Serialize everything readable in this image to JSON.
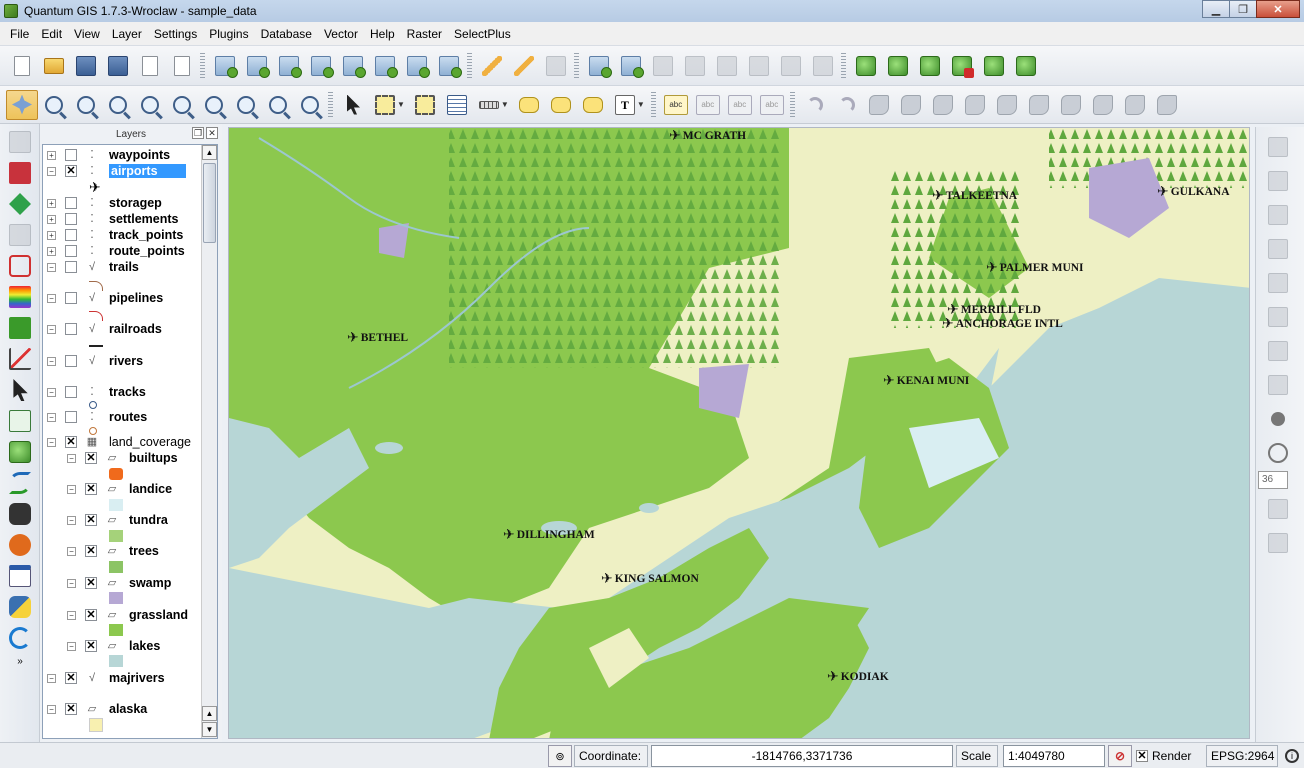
{
  "window": {
    "title": "Quantum GIS 1.7.3-Wroclaw - sample_data"
  },
  "menu": [
    {
      "label": "File"
    },
    {
      "label": "Edit"
    },
    {
      "label": "View"
    },
    {
      "label": "Layer"
    },
    {
      "label": "Settings"
    },
    {
      "label": "Plugins"
    },
    {
      "label": "Database"
    },
    {
      "label": "Vector"
    },
    {
      "label": "Help"
    },
    {
      "label": "Raster"
    },
    {
      "label": "SelectPlus"
    }
  ],
  "layers_panel": {
    "title": "Layers",
    "layers": [
      {
        "name": "waypoints",
        "checked": false,
        "selected": false
      },
      {
        "name": "airports",
        "checked": true,
        "selected": true
      },
      {
        "name": "storagep",
        "checked": false
      },
      {
        "name": "settlements",
        "checked": false
      },
      {
        "name": "track_points",
        "checked": false
      },
      {
        "name": "route_points",
        "checked": false
      },
      {
        "name": "trails",
        "checked": false
      },
      {
        "name": "pipelines",
        "checked": false
      },
      {
        "name": "railroads",
        "checked": false
      },
      {
        "name": "rivers",
        "checked": false
      },
      {
        "name": "tracks",
        "checked": false
      },
      {
        "name": "routes",
        "checked": false
      },
      {
        "name": "land_coverage",
        "checked": true,
        "group": true
      },
      {
        "name": "builtups",
        "checked": true,
        "color": "#f06a1c"
      },
      {
        "name": "landice",
        "checked": true,
        "color": "#d9eef2"
      },
      {
        "name": "tundra",
        "checked": true,
        "color": "#a5d27a"
      },
      {
        "name": "trees",
        "checked": true,
        "color": "#8cc465"
      },
      {
        "name": "swamp",
        "checked": true,
        "color": "#b6a8d4"
      },
      {
        "name": "grassland",
        "checked": true,
        "color": "#8cc84e"
      },
      {
        "name": "lakes",
        "checked": true,
        "color": "#b7d6d6"
      },
      {
        "name": "majrivers",
        "checked": true
      },
      {
        "name": "alaska",
        "checked": true,
        "color": "#f8f0b0"
      }
    ]
  },
  "map": {
    "places": [
      {
        "name": "MC GRATH"
      },
      {
        "name": "TALKEETNA"
      },
      {
        "name": "GULKANA"
      },
      {
        "name": "PALMER MUNI"
      },
      {
        "name": "MERRILL FLD"
      },
      {
        "name": "ANCHORAGE INTL"
      },
      {
        "name": "BETHEL"
      },
      {
        "name": "KENAI MUNI"
      },
      {
        "name": "DILLINGHAM"
      },
      {
        "name": "KING SALMON"
      },
      {
        "name": "KODIAK"
      }
    ],
    "colors": {
      "water": "#b7d6d6",
      "land": "#8cc84e",
      "tundra": "#eef0c4",
      "trees": "#5fa83e",
      "swamp": "#b6a8d4",
      "ice": "#d9eef2"
    }
  },
  "right_toolbar": {
    "spin_value": "36"
  },
  "status": {
    "coordinate_label": "Coordinate:",
    "coordinate_value": "-1814766,3371736",
    "scale_label": "Scale",
    "scale_value": "1:4049780",
    "render_label": "Render",
    "crs": "EPSG:2964"
  }
}
